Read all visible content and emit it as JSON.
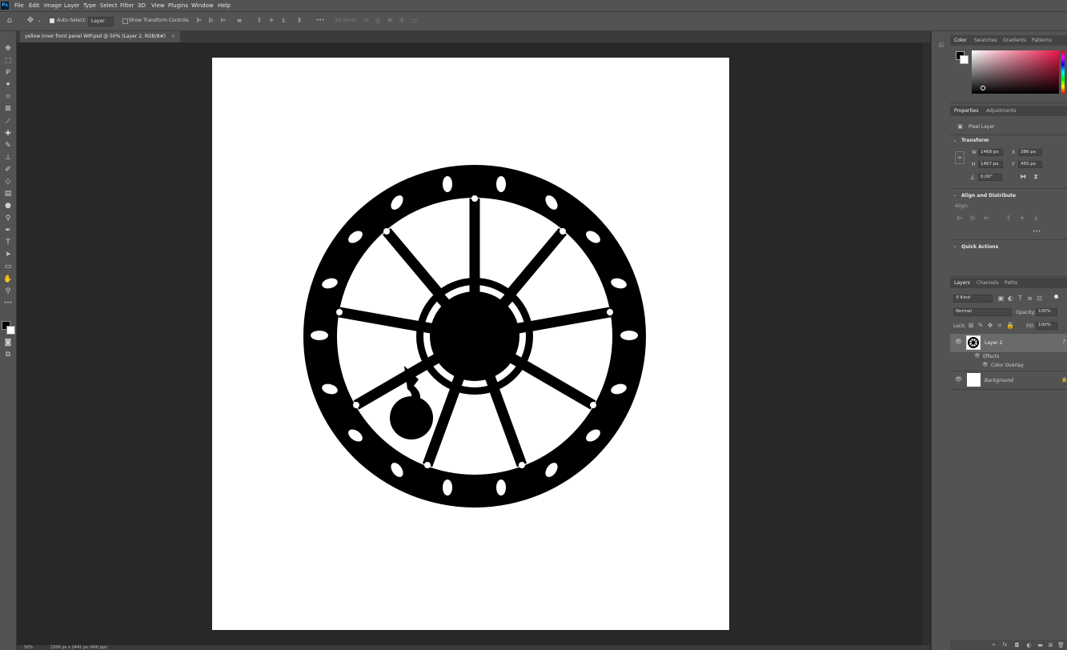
{
  "app": {
    "logo_text": "Ps"
  },
  "menu": [
    "File",
    "Edit",
    "Image",
    "Layer",
    "Type",
    "Select",
    "Filter",
    "3D",
    "View",
    "Plugins",
    "Window",
    "Help"
  ],
  "options_bar": {
    "auto_select_label": "Auto-Select:",
    "auto_select_target": "Layer",
    "show_transform_label": "Show Transform Controls",
    "mode_3d_label": "3D Mode:",
    "more_glyph": "•••"
  },
  "document": {
    "tab_title": "yellow inner front panel WIP.psd @ 50% (Layer 2, RGB/8#)",
    "close_glyph": "×"
  },
  "status": {
    "zoom": "50%",
    "doc_size": "2300 px x 2441 px (400 ppi)"
  },
  "color_panel": {
    "tabs": [
      "Color",
      "Swatches",
      "Gradients",
      "Patterns"
    ],
    "active_tab": "Color",
    "foreground": "#000000",
    "background": "#ffffff",
    "hue_color": "#e8194a"
  },
  "properties_panel": {
    "tabs": [
      "Properties",
      "Adjustments"
    ],
    "active_tab": "Properties",
    "layer_kind": "Pixel Layer",
    "transform_title": "Transform",
    "w_label": "W",
    "w_value": "1468 px",
    "h_label": "H",
    "h_value": "1467 px",
    "x_label": "X",
    "x_value": "386 px",
    "y_label": "Y",
    "y_value": "455 px",
    "angle_value": "0.00°",
    "align_title": "Align and Distribute",
    "align_label": "Align:",
    "more_glyph": "•••",
    "quick_actions_title": "Quick Actions"
  },
  "layers_panel": {
    "tabs": [
      "Layers",
      "Channels",
      "Paths"
    ],
    "active_tab": "Layers",
    "filter_kind": "Kind",
    "blend_mode": "Normal",
    "opacity_label": "Opacity:",
    "opacity_value": "100%",
    "lock_label": "Lock:",
    "fill_label": "Fill:",
    "fill_value": "100%",
    "layers": [
      {
        "name": "Layer 2",
        "selected": true
      },
      {
        "name": "Background",
        "selected": false
      }
    ],
    "effects_label": "Effects",
    "effect_name": "Color Overlay"
  }
}
